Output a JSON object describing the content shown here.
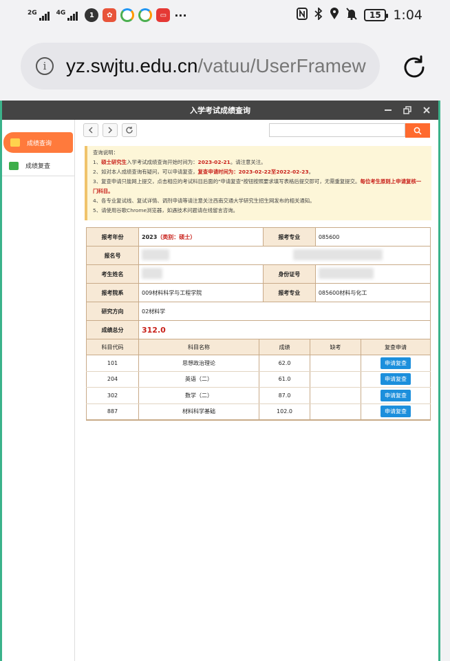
{
  "status_bar": {
    "sim1": "2G",
    "sim2": "4G",
    "battery": "15",
    "time": "1:04",
    "more": "···",
    "icons": [
      "nfc-icon",
      "bluetooth-icon",
      "location-icon",
      "mute-icon"
    ]
  },
  "browser": {
    "url_domain": "yz.swjtu.edu.cn",
    "url_path": "/vatuu/UserFramew"
  },
  "window": {
    "title": "入学考试成绩查询"
  },
  "sidebar": {
    "items": [
      {
        "label": "成绩查询",
        "active": true
      },
      {
        "label": "成绩复查",
        "active": false
      }
    ]
  },
  "notice": {
    "heading": "查询说明：",
    "line1_pre": "1、",
    "line1_red1": "硕士研究生",
    "line1_mid": "入学考试成绩查询开始时间为：",
    "line1_red2": "2023-02-21",
    "line1_post": "。请注意关注。",
    "line2_pre": "2、如对本人成绩查询有疑问，可以申请复查，",
    "line2_red": "复查申请时间为：2023-02-22至2022-02-23",
    "line2_post": "。",
    "line3_pre": "3、复查申请只能网上提交，点击相应的考试科目后面的\"申请复查\"按钮按照要求填写表格后提交即可，无需重复提交。",
    "line3_red": "每位考生原则上申请复核一门科目。",
    "line4": "4、各专业复试线、复试详情、调剂申请等请注意关注西南交通大学研究生招生网发布的相关通知。",
    "line5": "5、请使用谷歌Chrome浏览器，如遇技术问题请在线留言咨询。"
  },
  "info": {
    "year_label": "报考年份",
    "year_value": "2023",
    "year_category": "（类别：硕士）",
    "major_label": "报考专业",
    "major_value": "085600",
    "regno_label": "报名号",
    "name_label": "考生姓名",
    "id_label": "身份证号",
    "dept_label": "报考院系",
    "dept_value": "009材料科学与工程学院",
    "major2_label": "报考专业",
    "major2_value": "085600材料与化工",
    "direction_label": "研究方向",
    "direction_value": "02材料学",
    "total_label": "成绩总分",
    "total_value": "312.0"
  },
  "scores": {
    "headers": [
      "科目代码",
      "科目名称",
      "成绩",
      "缺考",
      "复查申请"
    ],
    "rows": [
      {
        "code": "101",
        "name": "思想政治理论",
        "score": "62.0",
        "absent": "",
        "button": "申请复查"
      },
      {
        "code": "204",
        "name": "英语（二）",
        "score": "61.0",
        "absent": "",
        "button": "申请复查"
      },
      {
        "code": "302",
        "name": "数学（二）",
        "score": "87.0",
        "absent": "",
        "button": "申请复查"
      },
      {
        "code": "887",
        "name": "材料科学基础",
        "score": "102.0",
        "absent": "",
        "button": "申请复查"
      }
    ]
  },
  "colors": {
    "accent": "#ff6a2e",
    "button": "#1c8fdc",
    "highlight_red": "#c8201a",
    "frame_border": "#3bb28a"
  }
}
